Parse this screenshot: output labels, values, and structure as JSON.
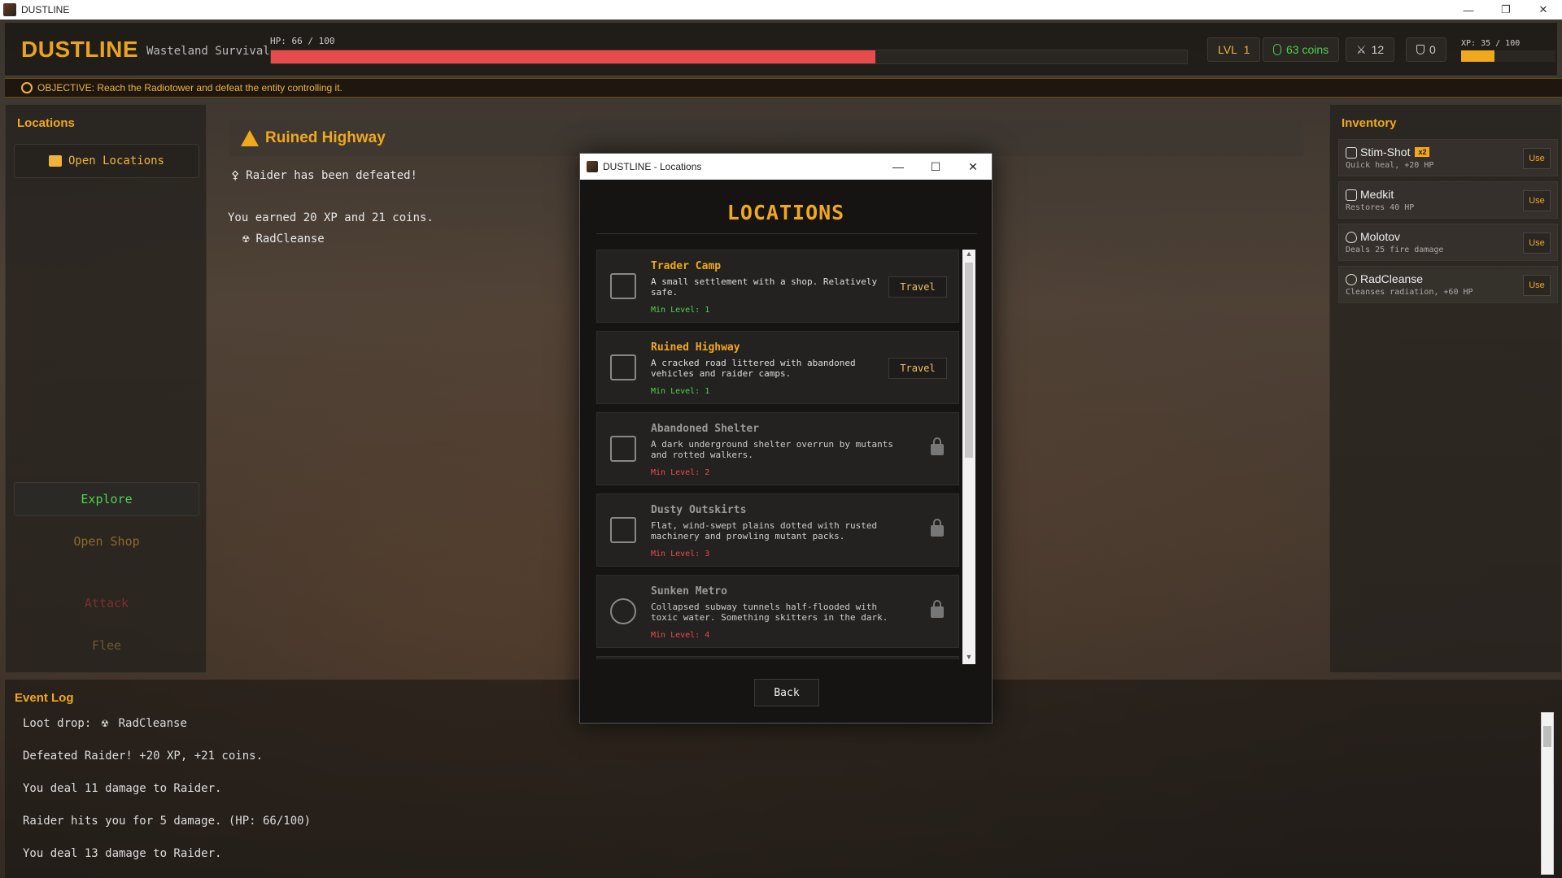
{
  "window": {
    "title": "DUSTLINE"
  },
  "hud": {
    "brand": "DUSTLINE",
    "tagline": "Wasteland Survival",
    "hp_label": "HP: 66 / 100",
    "hp_fraction": 0.66,
    "level_label": "LVL",
    "level_value": "1",
    "coins": "63 coins",
    "kills": "12",
    "armor": "0",
    "xp_label": "XP: 35 / 100",
    "xp_fraction": 0.35
  },
  "objective": "OBJECTIVE: Reach the Radiotower and defeat the entity controlling it.",
  "left": {
    "title": "Locations",
    "open_locations": "Open Locations",
    "explore": "Explore",
    "open_shop": "Open Shop",
    "attack": "Attack",
    "flee": "Flee"
  },
  "center": {
    "location_name": "Ruined Highway",
    "line1": "Raider has been defeated!",
    "line2": "You earned 20 XP and 21 coins.",
    "loot": "RadCleanse"
  },
  "inventory": {
    "title": "Inventory",
    "use_label": "Use",
    "items": [
      {
        "name": "Stim-Shot",
        "badge": "x2",
        "desc": "Quick heal, +20 HP"
      },
      {
        "name": "Medkit",
        "badge": "",
        "desc": "Restores 40 HP"
      },
      {
        "name": "Molotov",
        "badge": "",
        "desc": "Deals 25 fire damage"
      },
      {
        "name": "RadCleanse",
        "badge": "",
        "desc": "Cleanses radiation, +60 HP"
      }
    ]
  },
  "eventlog": {
    "title": "Event Log",
    "lines": [
      "Loot drop:",
      "RadCleanse",
      "Defeated Raider! +20 XP, +21 coins.",
      "You deal 11 damage to Raider.",
      "Raider hits you for 5 damage. (HP: 66/100)",
      "You deal 13 damage to Raider."
    ]
  },
  "modal": {
    "window_title": "DUSTLINE - Locations",
    "heading": "LOCATIONS",
    "travel_label": "Travel",
    "back_label": "Back",
    "locations": [
      {
        "name": "Trader Camp",
        "desc": "A small settlement with a shop. Relatively safe.",
        "level": "Min Level: 1",
        "locked": false
      },
      {
        "name": "Ruined Highway",
        "desc": "A cracked road littered with abandoned vehicles and raider camps.",
        "level": "Min Level: 1",
        "locked": false
      },
      {
        "name": "Abandoned Shelter",
        "desc": "A dark underground shelter overrun by mutants and rotted walkers.",
        "level": "Min Level: 2",
        "locked": true
      },
      {
        "name": "Dusty Outskirts",
        "desc": "Flat, wind-swept plains dotted with rusted machinery and prowling mutant packs.",
        "level": "Min Level: 3",
        "locked": true
      },
      {
        "name": "Sunken Metro",
        "desc": "Collapsed subway tunnels half-flooded with toxic water. Something skitters in the dark.",
        "level": "Min Level: 4",
        "locked": true
      }
    ]
  },
  "colors": {
    "accent": "#f0a81c",
    "hp": "#e84b4b",
    "green": "#4fd14f",
    "red": "#e84b4b"
  }
}
